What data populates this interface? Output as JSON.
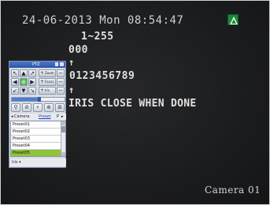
{
  "osd": {
    "datetime": "24-06-2013 Mon 08:54:47",
    "zoom": "1~255",
    "menu_id": "000",
    "arrow": "↑",
    "digits": "0123456789",
    "message": "IRIS CLOSE WHEN DONE",
    "camera": "Camera 01"
  },
  "ptz": {
    "title": "PTZ",
    "speed_fraction": 0.52,
    "pad": {
      "up_left": "↖",
      "up": "▲",
      "up_right": "↗",
      "left": "◀",
      "right": "▶",
      "down_left": "↙",
      "down": "▼",
      "down_right": "↘"
    },
    "rows": [
      {
        "label": "Zoom"
      },
      {
        "label": "Focus"
      },
      {
        "label": "Iris"
      }
    ],
    "tools": [
      "⚲",
      "⊘",
      "⚬",
      "⊕",
      "⊞"
    ],
    "tabs": {
      "prev": "◂",
      "camera": "Camera",
      "preset": "Preset",
      "p": "P",
      "next": "▸"
    },
    "presets": [
      "Preset01",
      "Preset02",
      "Preset03",
      "Preset04",
      "Preset05"
    ],
    "selected_preset": "Preset05",
    "footer": "Iris ▾"
  },
  "colors": {
    "screen_bg": "#1e1f21",
    "osd_text": "#d9d9d9",
    "signal_green": "#1a8a36",
    "selected_row": "#8fc33b",
    "titlebar": "#2d56ab"
  }
}
